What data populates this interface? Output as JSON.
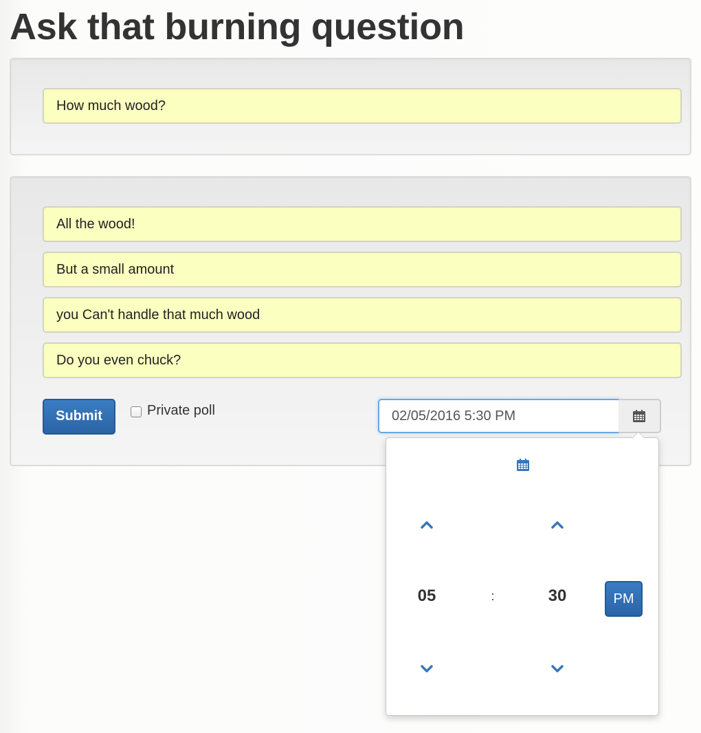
{
  "page": {
    "title": "Ask that burning question"
  },
  "question": {
    "value": "How much wood?"
  },
  "answers": [
    {
      "value": "All the wood!"
    },
    {
      "value": "But a small amount"
    },
    {
      "value": "you Can't handle that much wood"
    },
    {
      "value": "Do you even chuck?"
    }
  ],
  "form": {
    "submit_label": "Submit",
    "private_label": "Private poll",
    "private_checked": false,
    "datetime_value": "02/05/2016 5:30 PM"
  },
  "time_picker": {
    "hour": "05",
    "separator": ":",
    "minute": "30",
    "ampm": "PM",
    "icons": {
      "toggle": "calendar-icon",
      "hour_up": "chevron-up-icon",
      "hour_down": "chevron-down-icon",
      "minute_up": "chevron-up-icon",
      "minute_down": "chevron-down-icon"
    }
  },
  "colors": {
    "accent": "#2b64a6",
    "field_background": "#fbffbf",
    "icon_blue": "#3577bc"
  }
}
